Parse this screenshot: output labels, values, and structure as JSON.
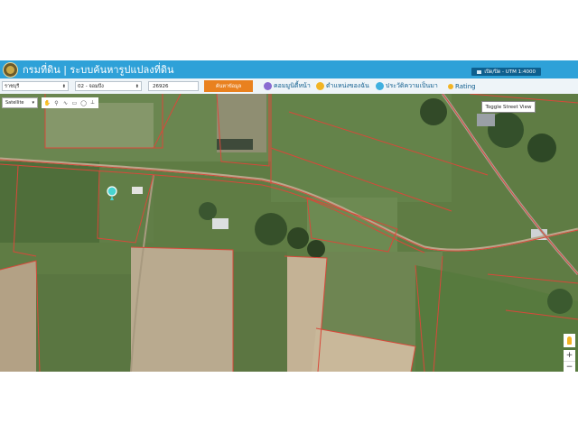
{
  "header": {
    "title": "กรมที่ดิน | ระบบค้นหารูปแปลงที่ดิน",
    "utm_label": "เปิด/ปิด - UTM 1:4000"
  },
  "toolbar": {
    "province": "ราชบุรี",
    "district": "02 - จอมบึง",
    "parcel_number": "26926",
    "search_label": "ค้นหาข้อมูล",
    "links": [
      {
        "label": "คอมมูนิตี้หน้า",
        "icon": "community-icon",
        "color": "#8a6bd1"
      },
      {
        "label": "ตำแหน่งของฉัน",
        "icon": "location-icon",
        "color": "#f2b424"
      },
      {
        "label": "ประวัติความเป็นมา",
        "icon": "history-icon",
        "color": "#3fb0e0"
      },
      {
        "label": "Rating",
        "icon": "rating-icon",
        "color": "#f2b424"
      }
    ]
  },
  "map": {
    "map_type": "Satellite",
    "toggle_street_view": "Toggle Street View",
    "zoom_in": "+",
    "zoom_out": "−",
    "tools": [
      "hand-icon",
      "marker-icon",
      "line-icon",
      "rectangle-icon",
      "circle-icon",
      "ruler-icon"
    ]
  },
  "colors": {
    "header_bg": "#2ea1d8",
    "search_button": "#e9811f",
    "parcel_lines": "#d8483a",
    "link_text": "#0d5c8d"
  }
}
